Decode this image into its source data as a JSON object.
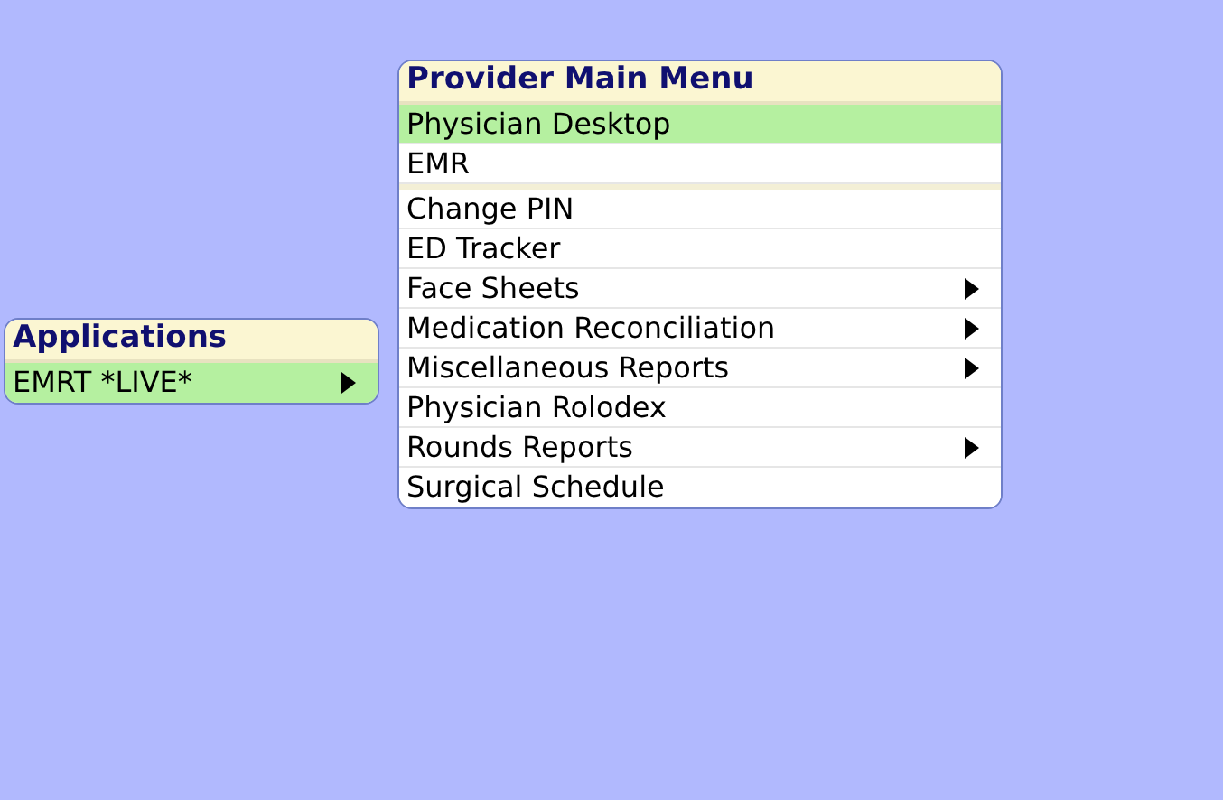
{
  "applications_menu": {
    "title": "Applications",
    "items": [
      {
        "label": "EMRT *LIVE*",
        "selected": true,
        "has_submenu": true
      }
    ]
  },
  "provider_menu": {
    "title": "Provider Main Menu",
    "sections": [
      [
        {
          "label": "Physician Desktop",
          "selected": true,
          "has_submenu": false
        },
        {
          "label": "EMR",
          "selected": false,
          "has_submenu": false
        }
      ],
      [
        {
          "label": "Change PIN",
          "selected": false,
          "has_submenu": false
        },
        {
          "label": "ED Tracker",
          "selected": false,
          "has_submenu": false
        },
        {
          "label": "Face Sheets",
          "selected": false,
          "has_submenu": true
        },
        {
          "label": "Medication Reconciliation",
          "selected": false,
          "has_submenu": true
        },
        {
          "label": "Miscellaneous Reports",
          "selected": false,
          "has_submenu": true
        },
        {
          "label": "Physician Rolodex",
          "selected": false,
          "has_submenu": false
        },
        {
          "label": "Rounds Reports",
          "selected": false,
          "has_submenu": true
        },
        {
          "label": "Surgical Schedule",
          "selected": false,
          "has_submenu": false
        }
      ]
    ]
  }
}
